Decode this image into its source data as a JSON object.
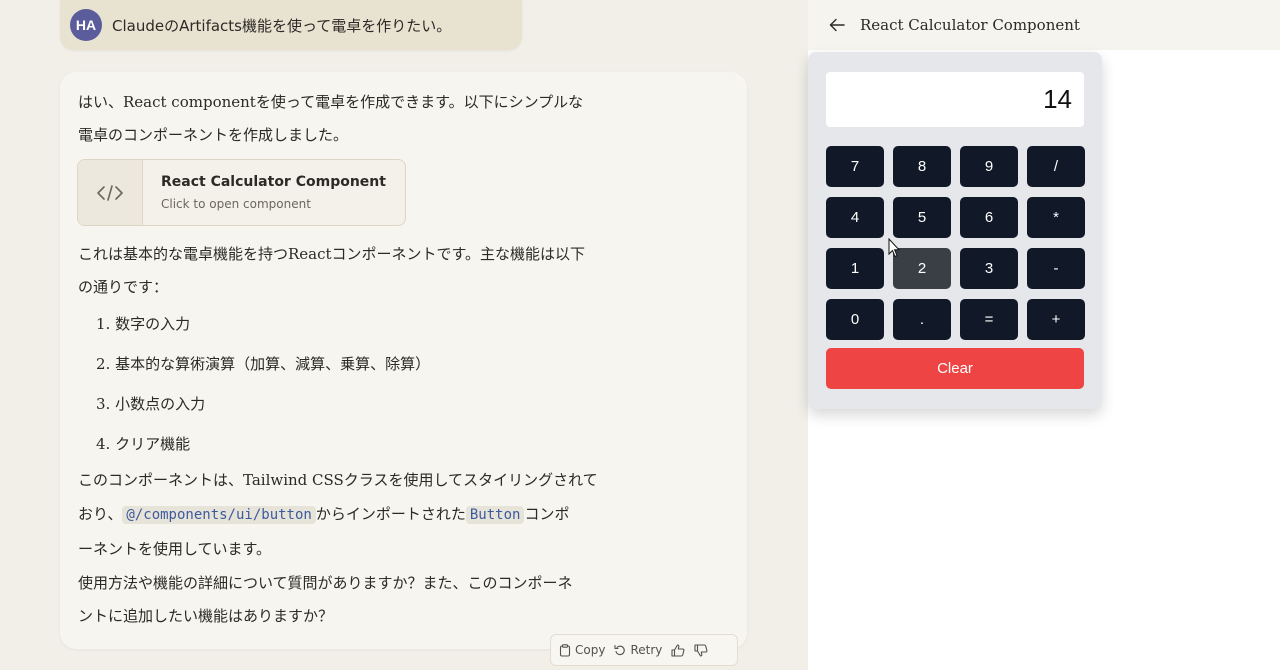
{
  "user_message": {
    "avatar": "HA",
    "text": "ClaudeのArtifacts機能を使って電卓を作りたい。"
  },
  "reply": {
    "intro_line1": "はい、React componentを使って電卓を作成できます。以下にシンプルな",
    "intro_line2": "電卓のコンポーネントを作成しました。",
    "artifact_card": {
      "icon": "code-icon",
      "title": "React Calculator Component",
      "subtitle": "Click to open component"
    },
    "features_line1": "これは基本的な電卓機能を持つReactコンポーネントです。主な機能は以下",
    "features_line2": "の通りです：",
    "features": [
      "1. 数字の入力",
      "2. 基本的な算術演算（加算、減算、乗算、除算）",
      "3. 小数点の入力",
      "4. クリア機能"
    ],
    "tailwind_line1": "このコンポーネントは、Tailwind CSSクラスを使用してスタイリングされて",
    "tailwind_pre": "おり、",
    "tailwind_code1": "@/components/ui/button",
    "tailwind_mid": "からインポートされた",
    "tailwind_code2": "Button",
    "tailwind_post": "コンポ",
    "tailwind_line3": "ーネントを使用しています。",
    "question_line1": "使用方法や機能の詳細について質問がありますか？また、このコンポーネ",
    "question_line2": "ントに追加したい機能はありますか？",
    "actions": {
      "copy": "Copy",
      "retry": "Retry"
    }
  },
  "artifact_pane": {
    "back_icon": "arrow-left-icon",
    "title": "React Calculator Component",
    "calculator": {
      "display": "14",
      "keys": [
        "7",
        "8",
        "9",
        "/",
        "4",
        "5",
        "6",
        "*",
        "1",
        "2",
        "3",
        "-",
        "0",
        ".",
        "=",
        "+"
      ],
      "hovered_key": "2",
      "clear_label": "Clear",
      "colors": {
        "key_bg": "#111827",
        "clear_bg": "#ef4444",
        "panel_bg": "#e5e7eb"
      }
    }
  }
}
